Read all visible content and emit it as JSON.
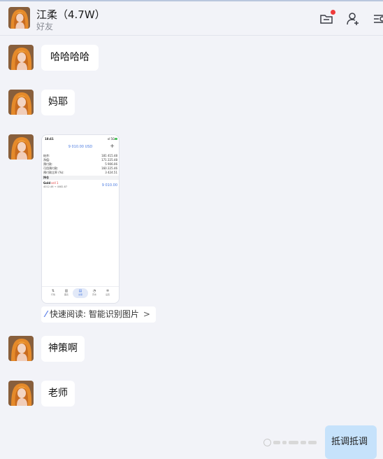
{
  "header": {
    "contact_name": "江柔（4.7W）",
    "contact_type": "好友",
    "icons": [
      "folder-icon",
      "add-friend-icon",
      "more-menu-icon"
    ]
  },
  "messages": [
    {
      "type": "text",
      "text": "哈哈哈哈"
    },
    {
      "type": "text",
      "text": "妈耶"
    },
    {
      "type": "image",
      "quick_read_label": "快速阅读: 智能识别图片",
      "quick_read_arrow": ">"
    },
    {
      "type": "text",
      "text": "神策啊"
    },
    {
      "type": "text",
      "text": "老师"
    }
  ],
  "outgoing": {
    "text": "抵调抵调"
  },
  "screenshot": {
    "time": "18:41",
    "signal": "ııl 5G",
    "balance": "9 010.00 USD",
    "plus": "+",
    "rows": [
      {
        "label": "结余:",
        "value": "181 415.48"
      },
      {
        "label": "净值:",
        "value": "171 225.48"
      },
      {
        "label": "预付款:",
        "value": "5 906.06"
      },
      {
        "label": "可用预付款:",
        "value": "160 225.46"
      },
      {
        "label": "预付款比率 (%):",
        "value": "3 424.51"
      }
    ],
    "section": "持仓",
    "position_symbol": "Gold",
    "position_side": "sell 1",
    "position_prices": "4012.46 → 4082.87",
    "position_profit": "9 010.00",
    "tabs": [
      "行情",
      "图表",
      "交易",
      "历史",
      "设置"
    ]
  },
  "colors": {
    "accent": "#5b7fe8",
    "bubble_out": "#c6e2fb",
    "background": "#f2f3f8",
    "badge": "#ef3b3b"
  }
}
